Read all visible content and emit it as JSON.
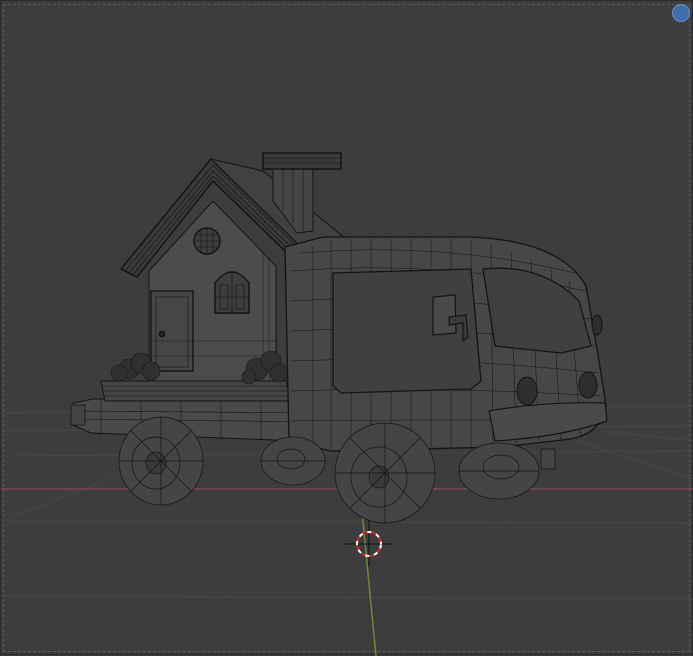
{
  "viewport": {
    "mode": "wireframe",
    "background_color": "#3d3d3d",
    "grid_color": "#474747",
    "x_axis_color": "#9c4a55",
    "y_axis_color": "#6d8a3a",
    "wire_color": "#141414",
    "face_color": "#4a4a4a"
  },
  "scene": {
    "object": "house-truck",
    "cursor": "3d-cursor",
    "gizmo": "navigation-gizmo"
  }
}
